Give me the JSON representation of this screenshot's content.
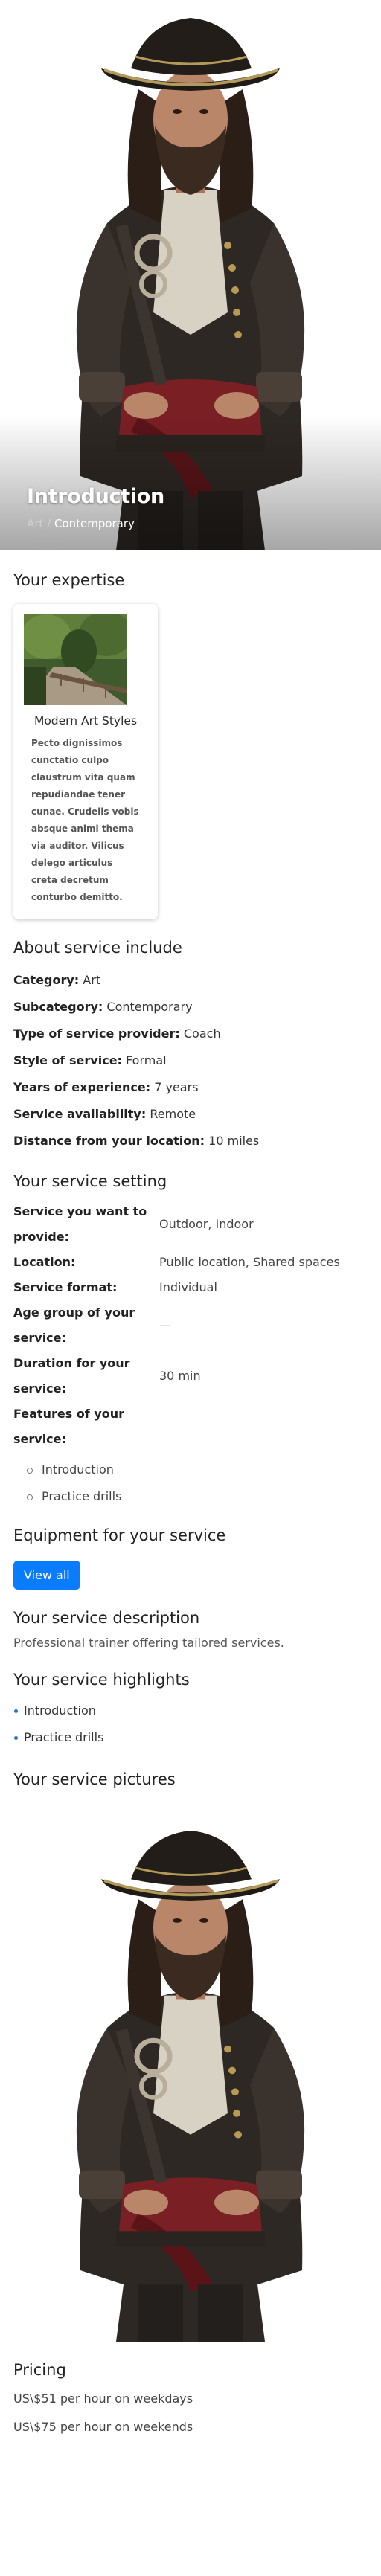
{
  "hero": {
    "title": "Introduction",
    "subtitle_prefix": "Art",
    "subtitle_separator": "/",
    "subtitle": "Contemporary",
    "image": "pirate-portrait-image"
  },
  "expertise": {
    "heading": "Your expertise",
    "card": {
      "image": "forest-path-image",
      "title": "Modern Art Styles",
      "description": "Pecto dignissimos cunctatio culpo claustrum vita quam repudiandae tener cunae. Crudelis vobis absque animi thema via auditor. Vilicus delego articulus creta decretum conturbo demitto."
    }
  },
  "about": {
    "heading": "About service include",
    "rows": [
      {
        "label": "Category:",
        "value": "Art"
      },
      {
        "label": "Subcategory:",
        "value": "Contemporary"
      },
      {
        "label": "Type of service provider:",
        "value": "Coach"
      },
      {
        "label": "Style of service:",
        "value": "Formal"
      },
      {
        "label": "Years of experience:",
        "value": "7 years"
      },
      {
        "label": "Service availability:",
        "value": "Remote"
      },
      {
        "label": "Distance from your location:",
        "value": "10 miles"
      }
    ]
  },
  "setting": {
    "heading": "Your service setting",
    "rows": [
      {
        "label": "Service you want to provide:",
        "value": "Outdoor, Indoor"
      },
      {
        "label": "Location:",
        "value": "Public location, Shared spaces"
      },
      {
        "label": "Service format:",
        "value": "Individual"
      },
      {
        "label": "Age group of your service:",
        "value": "—"
      },
      {
        "label": "Duration for your service:",
        "value": "30 min"
      },
      {
        "label": "Features of your service:",
        "value": ""
      }
    ],
    "features": [
      "Introduction",
      "Practice drills"
    ]
  },
  "equipment": {
    "heading": "Equipment for your service",
    "button_label": "View all"
  },
  "description": {
    "heading": "Your service description",
    "text": "Professional trainer offering tailored services."
  },
  "highlights": {
    "heading": "Your service highlights",
    "items": [
      "Introduction",
      "Practice drills"
    ]
  },
  "pictures": {
    "heading": "Your service pictures",
    "image": "pirate-portrait-image"
  },
  "pricing": {
    "heading": "Pricing",
    "weekday": "US\\$51 per hour on weekdays",
    "weekend": "US\\$75 per hour on weekends"
  },
  "colors": {
    "accent": "#0a7cff",
    "bullet": "#2a6fd6"
  }
}
